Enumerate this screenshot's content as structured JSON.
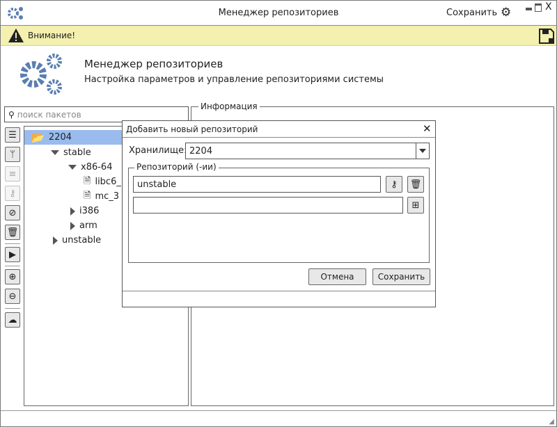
{
  "window": {
    "title": "Менеджер репозиториев",
    "save_label": "Сохранить"
  },
  "warning": {
    "text": "Внимание!"
  },
  "header": {
    "title": "Менеджер репозиториев",
    "subtitle": "Настройка параметров и управление репозиториями системы"
  },
  "search": {
    "placeholder": "поиск пакетов"
  },
  "tree": {
    "root": "2204",
    "stable": "stable",
    "x86": "x86-64",
    "pkg1": "libc6_",
    "pkg2": "mc_3",
    "i386": "i386",
    "arm": "arm",
    "unstable": "unstable"
  },
  "info": {
    "legend": "Информация"
  },
  "dialog": {
    "title": "Добавить новый репозиторий",
    "storage_label": "Хранилище:",
    "storage_value": "2204",
    "repos_legend": "Репозиторий (-ии)",
    "repo1": "unstable",
    "repo2": "",
    "cancel": "Отмена",
    "save": "Сохранить"
  },
  "colors": {
    "accent": "#5a7fb0",
    "warning_bg": "#f3f0b0",
    "selected": "#99bbee"
  }
}
